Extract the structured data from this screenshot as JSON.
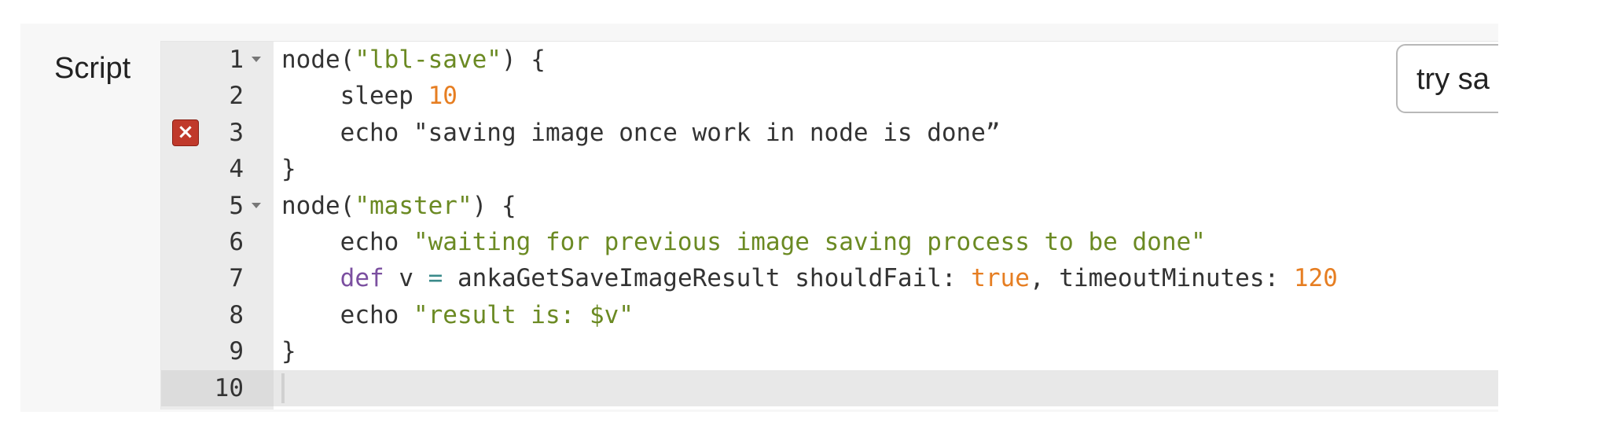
{
  "form": {
    "script_label": "Script",
    "try_sample_label": "try sa"
  },
  "editor": {
    "active_line": 10,
    "error_line": 3,
    "lines": [
      {
        "number": "1",
        "fold": true,
        "tokens": [
          {
            "t": "node(",
            "c": ""
          },
          {
            "t": "\"lbl-save\"",
            "c": "str"
          },
          {
            "t": ") {",
            "c": ""
          }
        ]
      },
      {
        "number": "2",
        "fold": false,
        "tokens": [
          {
            "t": "    sleep ",
            "c": ""
          },
          {
            "t": "10",
            "c": "num"
          }
        ]
      },
      {
        "number": "3",
        "fold": false,
        "error": true,
        "tokens": [
          {
            "t": "    echo \"saving image once work in node is done”",
            "c": ""
          }
        ]
      },
      {
        "number": "4",
        "fold": false,
        "tokens": [
          {
            "t": "}",
            "c": ""
          }
        ]
      },
      {
        "number": "5",
        "fold": true,
        "tokens": [
          {
            "t": "node(",
            "c": ""
          },
          {
            "t": "\"master\"",
            "c": "str"
          },
          {
            "t": ") {",
            "c": ""
          }
        ]
      },
      {
        "number": "6",
        "fold": false,
        "tokens": [
          {
            "t": "    echo ",
            "c": ""
          },
          {
            "t": "\"waiting for previous image saving process to be done\"",
            "c": "str"
          }
        ]
      },
      {
        "number": "7",
        "fold": false,
        "tokens": [
          {
            "t": "    ",
            "c": ""
          },
          {
            "t": "def",
            "c": "kw"
          },
          {
            "t": " v ",
            "c": ""
          },
          {
            "t": "=",
            "c": "op"
          },
          {
            "t": " ankaGetSaveImageResult shouldFail: ",
            "c": ""
          },
          {
            "t": "true",
            "c": "num"
          },
          {
            "t": ", timeoutMinutes: ",
            "c": ""
          },
          {
            "t": "120",
            "c": "num"
          }
        ]
      },
      {
        "number": "8",
        "fold": false,
        "tokens": [
          {
            "t": "    echo ",
            "c": ""
          },
          {
            "t": "\"result is: $v\"",
            "c": "str"
          }
        ]
      },
      {
        "number": "9",
        "fold": false,
        "tokens": [
          {
            "t": "}",
            "c": ""
          }
        ]
      },
      {
        "number": "10",
        "fold": false,
        "tokens": []
      }
    ]
  },
  "colors": {
    "string": "#6b8a23",
    "number": "#e67e22",
    "keyword": "#7b4fa0",
    "error": "#c0392b"
  },
  "icons": {
    "error_marker": "error-x-icon",
    "fold_marker": "fold-arrow-icon"
  }
}
